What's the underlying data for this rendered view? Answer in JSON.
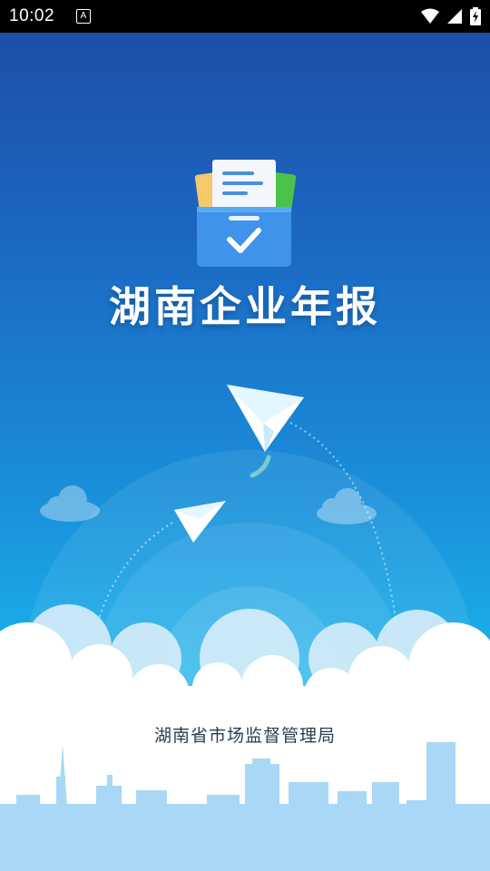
{
  "status_bar": {
    "time": "10:02",
    "app_indicator": "A",
    "icons": [
      "wifi-icon",
      "cellular-signal-icon",
      "battery-charging-icon"
    ]
  },
  "splash": {
    "title": "湖南企业年报",
    "organization": "湖南省市场监督管理局"
  },
  "colors": {
    "sky_top": "#1d4ea8",
    "sky_bottom": "#1ab7ee",
    "skyline": "#a8d8f6",
    "title_text": "#ffffff",
    "org_text": "#2b3b52"
  }
}
